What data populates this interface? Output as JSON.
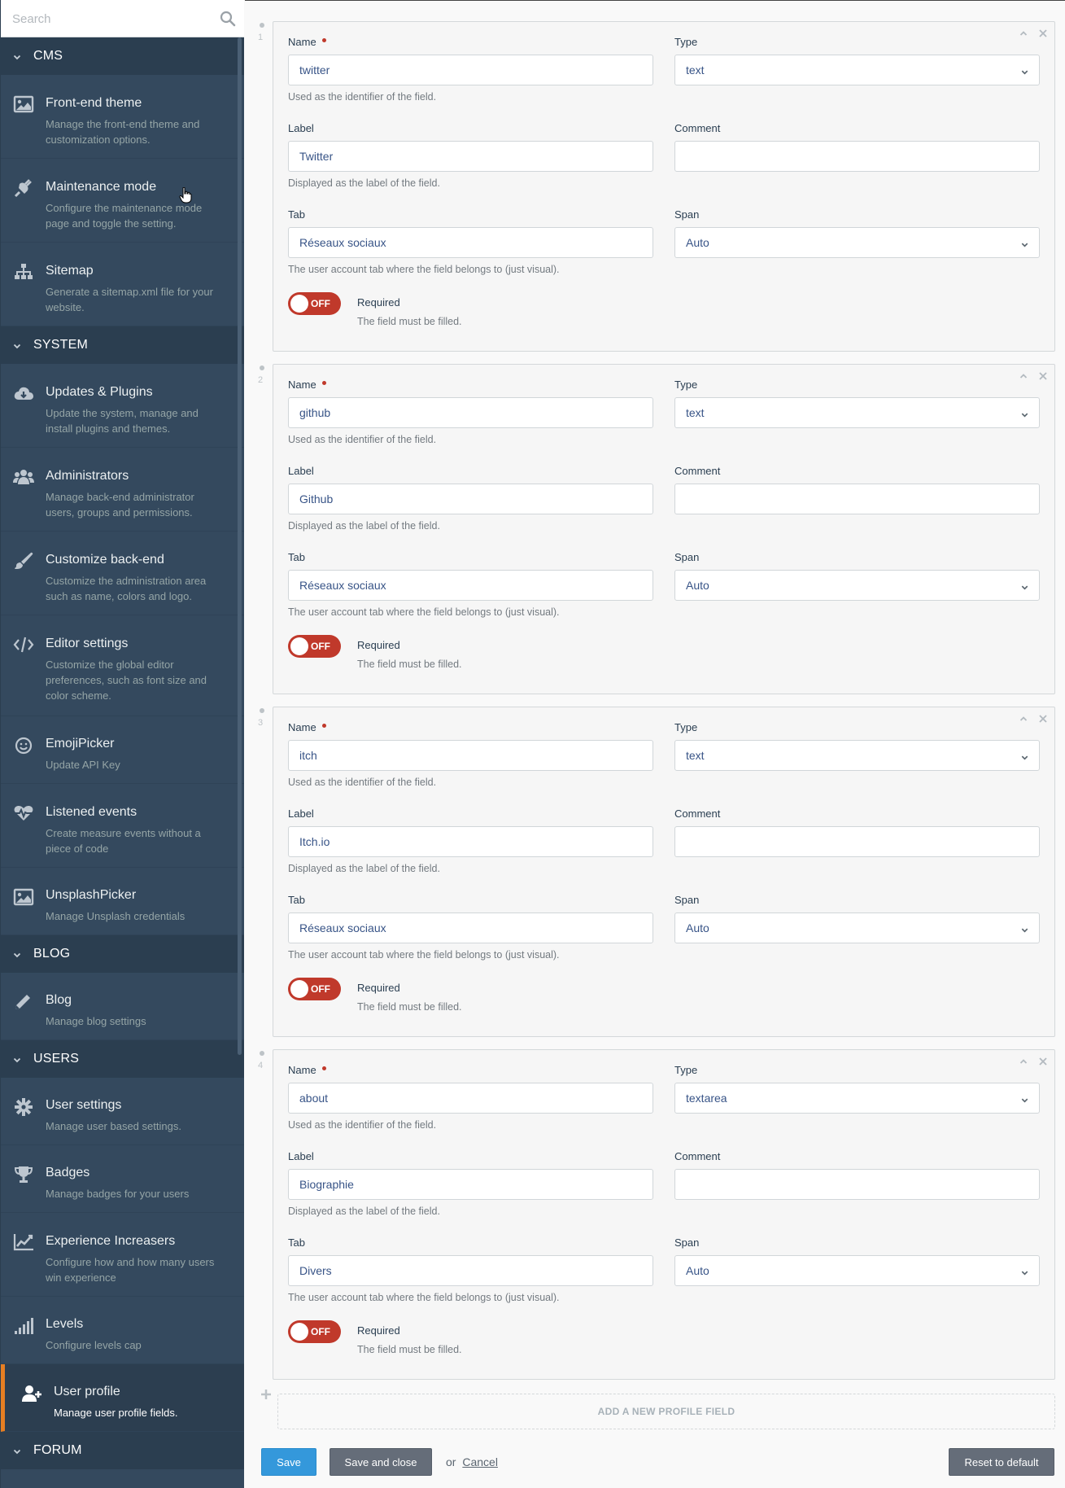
{
  "search": {
    "placeholder": "Search"
  },
  "sidebar": {
    "categories": [
      {
        "label": "CMS",
        "items": [
          {
            "title": "Front-end theme",
            "desc": "Manage the front-end theme and customization options.",
            "icon": "image-icon"
          },
          {
            "title": "Maintenance mode",
            "desc": "Configure the maintenance mode page and toggle the setting.",
            "icon": "plug-icon"
          },
          {
            "title": "Sitemap",
            "desc": "Generate a sitemap.xml file for your website.",
            "icon": "sitemap-icon"
          }
        ]
      },
      {
        "label": "SYSTEM",
        "items": [
          {
            "title": "Updates & Plugins",
            "desc": "Update the system, manage and install plugins and themes.",
            "icon": "cloud-download-icon"
          },
          {
            "title": "Administrators",
            "desc": "Manage back-end administrator users, groups and permissions.",
            "icon": "users-icon"
          },
          {
            "title": "Customize back-end",
            "desc": "Customize the administration area such as name, colors and logo.",
            "icon": "paint-brush-icon"
          },
          {
            "title": "Editor settings",
            "desc": "Customize the global editor preferences, such as font size and color scheme.",
            "icon": "code-icon"
          },
          {
            "title": "EmojiPicker",
            "desc": "Update API Key",
            "icon": "smile-icon"
          },
          {
            "title": "Listened events",
            "desc": "Create measure events without a piece of code",
            "icon": "heartbeat-icon"
          },
          {
            "title": "UnsplashPicker",
            "desc": "Manage Unsplash credentials",
            "icon": "image-icon"
          }
        ]
      },
      {
        "label": "BLOG",
        "items": [
          {
            "title": "Blog",
            "desc": "Manage blog settings",
            "icon": "pencil-icon"
          }
        ]
      },
      {
        "label": "USERS",
        "items": [
          {
            "title": "User settings",
            "desc": "Manage user based settings.",
            "icon": "gear-icon"
          },
          {
            "title": "Badges",
            "desc": "Manage badges for your users",
            "icon": "trophy-icon"
          },
          {
            "title": "Experience Increasers",
            "desc": "Configure how and how many users win experience",
            "icon": "line-chart-icon"
          },
          {
            "title": "Levels",
            "desc": "Configure levels cap",
            "icon": "signal-icon"
          },
          {
            "title": "User profile",
            "desc": "Manage user profile fields.",
            "icon": "user-plus-icon",
            "active": true
          }
        ]
      },
      {
        "label": "FORUM",
        "items": []
      }
    ]
  },
  "form": {
    "labels": {
      "name": "Name",
      "type": "Type",
      "label": "Label",
      "comment": "Comment",
      "tab": "Tab",
      "span": "Span",
      "required": "Required"
    },
    "help": {
      "name": "Used as the identifier of the field.",
      "label": "Displayed as the label of the field.",
      "tab": "The user account tab where the field belongs to (just visual).",
      "required": "The field must be filled."
    },
    "switch_off": "OFF",
    "fields": [
      {
        "index": "1",
        "name": "twitter",
        "type": "text",
        "label": "Twitter",
        "comment": "",
        "tab": "Réseaux sociaux",
        "span": "Auto"
      },
      {
        "index": "2",
        "name": "github",
        "type": "text",
        "label": "Github",
        "comment": "",
        "tab": "Réseaux sociaux",
        "span": "Auto"
      },
      {
        "index": "3",
        "name": "itch",
        "type": "text",
        "label": "Itch.io",
        "comment": "",
        "tab": "Réseaux sociaux",
        "span": "Auto"
      },
      {
        "index": "4",
        "name": "about",
        "type": "textarea",
        "label": "Biographie",
        "comment": "",
        "tab": "Divers",
        "span": "Auto"
      }
    ],
    "add_label": "ADD A NEW PROFILE FIELD"
  },
  "actions": {
    "save": "Save",
    "save_close": "Save and close",
    "or": "or",
    "cancel": "Cancel",
    "reset": "Reset to default"
  },
  "colors": {
    "sidebar_bg": "#34495e",
    "sidebar_header": "#2b3e50",
    "active_accent": "#e67e22",
    "primary": "#3498db",
    "switch_off": "#c0392b"
  }
}
